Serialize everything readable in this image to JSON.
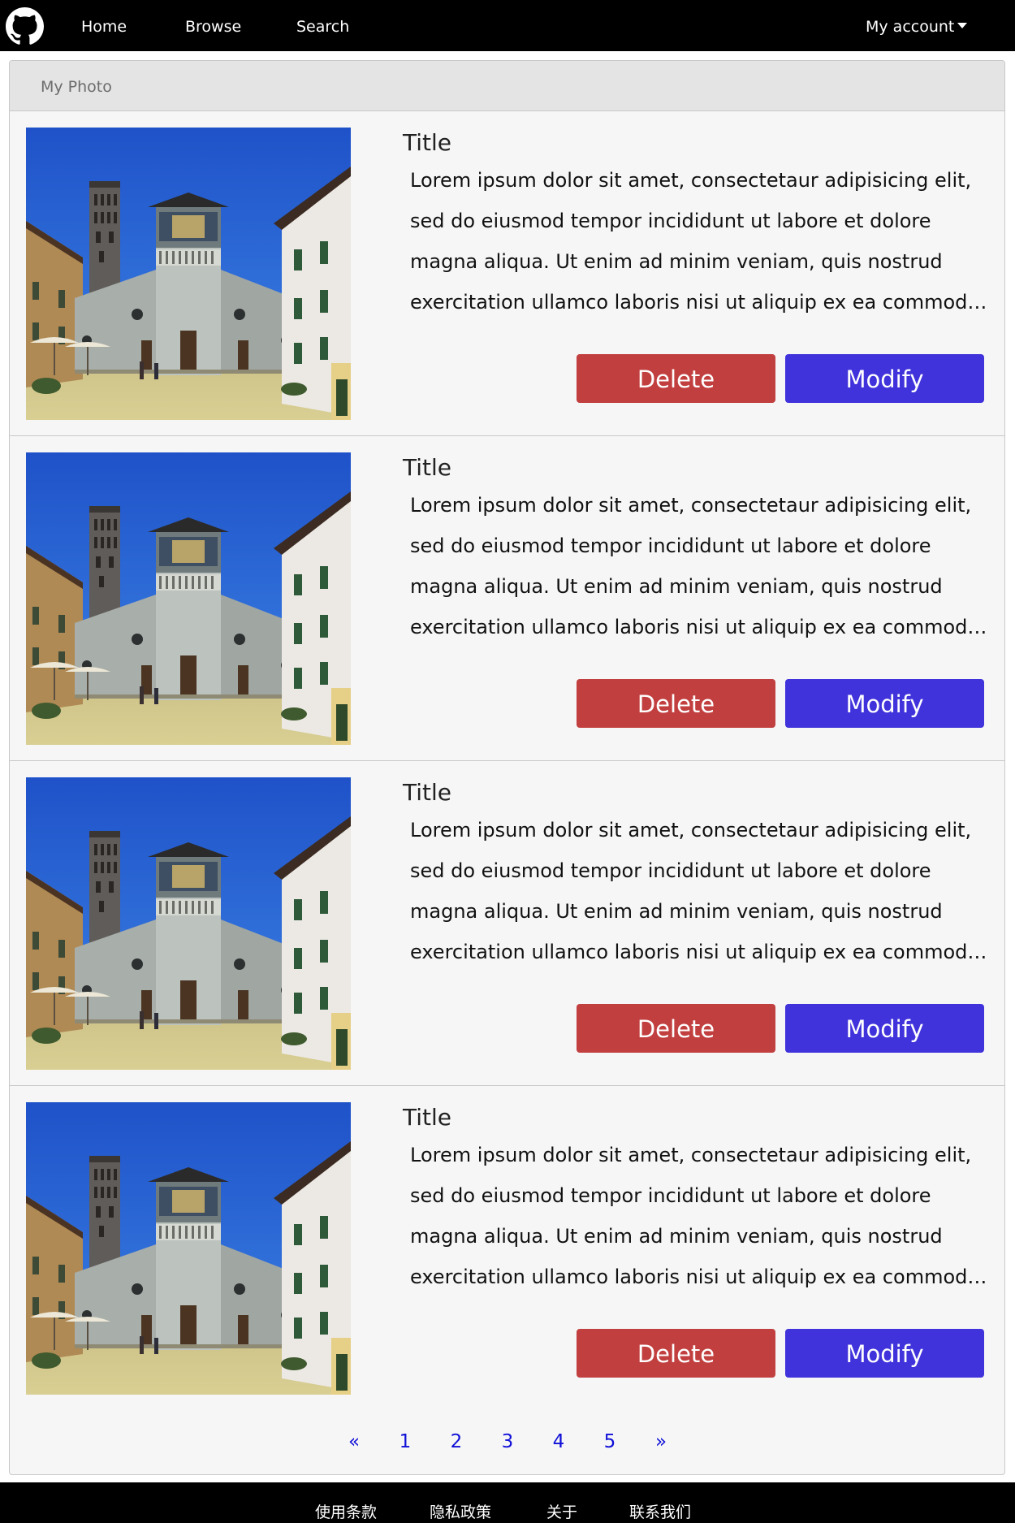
{
  "navbar": {
    "logo_icon": "github-icon",
    "links": {
      "home": "Home",
      "browse": "Browse",
      "search": "Search"
    },
    "account_label": "My account"
  },
  "card": {
    "header_title": "My Photo"
  },
  "items": [
    {
      "title": "Title",
      "description": "Lorem ipsum dolor sit amet, consectetaur adipisicing elit, sed do eiusmod tempor incididunt ut labore et dolore magna aliqua. Ut enim ad minim veniam, quis nostrud exercitation ullamco laboris nisi ut aliquip ex ea commodo consequat. Duis aute irure dolor in reprehenderit",
      "delete_label": "Delete",
      "modify_label": "Modify"
    },
    {
      "title": "Title",
      "description": "Lorem ipsum dolor sit amet, consectetaur adipisicing elit, sed do eiusmod tempor incididunt ut labore et dolore magna aliqua. Ut enim ad minim veniam, quis nostrud exercitation ullamco laboris nisi ut aliquip ex ea commodo consequat. Duis aute irure dolor in reprehenderit",
      "delete_label": "Delete",
      "modify_label": "Modify"
    },
    {
      "title": "Title",
      "description": "Lorem ipsum dolor sit amet, consectetaur adipisicing elit, sed do eiusmod tempor incididunt ut labore et dolore magna aliqua. Ut enim ad minim veniam, quis nostrud exercitation ullamco laboris nisi ut aliquip ex ea commodo consequat. Duis aute irure dolor in reprehenderit",
      "delete_label": "Delete",
      "modify_label": "Modify"
    },
    {
      "title": "Title",
      "description": "Lorem ipsum dolor sit amet, consectetaur adipisicing elit, sed do eiusmod tempor incididunt ut labore et dolore magna aliqua. Ut enim ad minim veniam, quis nostrud exercitation ullamco laboris nisi ut aliquip ex ea commodo consequat. Duis aute irure dolor in reprehenderit",
      "delete_label": "Delete",
      "modify_label": "Modify"
    }
  ],
  "pagination": {
    "prev": "«",
    "pages": [
      "1",
      "2",
      "3",
      "4",
      "5"
    ],
    "next": "»"
  },
  "footer": {
    "links": [
      "使用条款",
      "隐私政策",
      "关于",
      "联系我们"
    ]
  },
  "colors": {
    "delete": "#c23f3f",
    "modify": "#4033db",
    "page_link": "#1010d8"
  }
}
